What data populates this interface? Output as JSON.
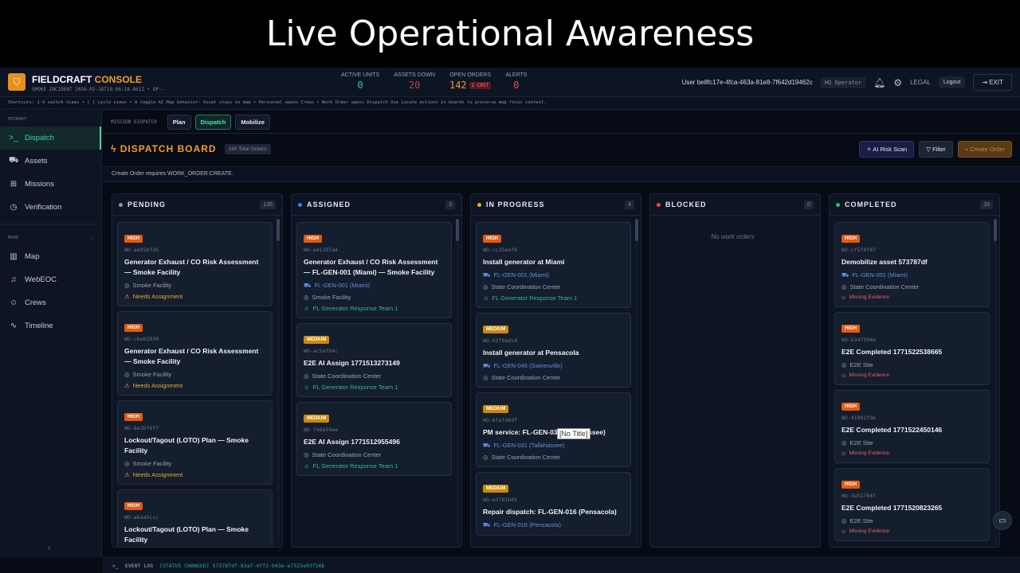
{
  "slide_title": "Live Operational Awareness",
  "header": {
    "brand_a": "FIELDCRAFT",
    "brand_b": "CONSOLE",
    "subtitle": "SMOKE INCIDENT 2026-02-16T19:06:18.861Z • OP--",
    "stats": [
      {
        "label": "ACTIVE UNITS",
        "value": "0",
        "color": "#2fc79a"
      },
      {
        "label": "ASSETS DOWN",
        "value": "20",
        "color": "#b8464c"
      },
      {
        "label": "OPEN ORDERS",
        "value": "142",
        "color": "#f1a02a",
        "badge": "1 CRIT"
      },
      {
        "label": "ALERTS",
        "value": "0",
        "color": "#e2555c"
      }
    ],
    "user": "User be8fc17e-4fca-463a-81e8-7f642d19462c",
    "role": "HQ Operator",
    "legal": "LEGAL",
    "logout": "Logout",
    "exit": "EXIT"
  },
  "shortcuts": "Shortcuts: 1-9 switch views • [ ] cycle views • A toggle AI    Map behavior: Asset stays on map • Personnel opens Crews • Work Order opens Dispatch    Use Locate actions in boards to preserve map focus context.",
  "sidebar": {
    "primary_label": "PRIMARY",
    "more_label": "MORE",
    "primary": [
      {
        "label": "Dispatch",
        "icon": "terminal-icon",
        "g": ">_",
        "active": true
      },
      {
        "label": "Assets",
        "icon": "truck-icon",
        "g": "⛟"
      },
      {
        "label": "Missions",
        "icon": "grid-icon",
        "g": "⊞"
      },
      {
        "label": "Verification",
        "icon": "check-circle-icon",
        "g": "◷"
      }
    ],
    "more": [
      {
        "label": "Map",
        "icon": "map-icon",
        "g": "▥"
      },
      {
        "label": "WebEOC",
        "icon": "bell-icon",
        "g": "♫"
      },
      {
        "label": "Crews",
        "icon": "users-icon",
        "g": "☺"
      },
      {
        "label": "Timeline",
        "icon": "activity-icon",
        "g": "∿"
      }
    ]
  },
  "mission": {
    "label": "MISSION DISPATCH",
    "tabs": [
      {
        "label": "Plan"
      },
      {
        "label": "Dispatch",
        "active": true
      },
      {
        "label": "Mobilize"
      }
    ]
  },
  "board": {
    "title": "DISPATCH BOARD",
    "total": "160 Total Orders",
    "ai": "AI Risk Scan",
    "filter": "Filter",
    "create": "+ Create Order",
    "note": "Create Order requires WORK_ORDER:CREATE.",
    "empty": "No work orders"
  },
  "columns": [
    {
      "name": "PENDING",
      "count": "135",
      "color": "#8a93a3",
      "cards": [
        {
          "p": "HIGH",
          "id": "WO-add5bf26",
          "title": "Generator Exhaust / CO Risk Assessment — Smoke Facility",
          "loc": "Smoke Facility",
          "flag": "Needs Assignment"
        },
        {
          "p": "HIGH",
          "id": "WO-cbeb2838",
          "title": "Generator Exhaust / CO Risk Assessment — Smoke Facility",
          "loc": "Smoke Facility",
          "flag": "Needs Assignment"
        },
        {
          "p": "HIGH",
          "id": "WO-8e2bf4ff",
          "title": "Lockout/Tagout (LOTO) Plan — Smoke Facility",
          "loc": "Smoke Facility",
          "flag": "Needs Assignment"
        },
        {
          "p": "HIGH",
          "id": "WO-a6aa5ccc",
          "title": "Lockout/Tagout (LOTO) Plan — Smoke Facility"
        }
      ]
    },
    {
      "name": "ASSIGNED",
      "count": "3",
      "color": "#3b82f6",
      "cards": [
        {
          "p": "HIGH",
          "id": "WO-e41387a4",
          "title": "Generator Exhaust / CO Risk Assessment — FL-GEN-001 (Miami) — Smoke Facility",
          "asset": "FL-GEN-001 (Miami)",
          "loc": "Smoke Facility",
          "team": "FL Generator Response Team 1"
        },
        {
          "p": "MEDIUM",
          "id": "WO-ac5afb4c",
          "title": "E2E AI Assign 1771513273149",
          "loc": "State Coordination Center",
          "team": "FL Generator Response Team 1"
        },
        {
          "p": "MEDIUM",
          "id": "WO-f46e59ee",
          "title": "E2E AI Assign 1771512955496",
          "loc": "State Coordination Center",
          "team": "FL Generator Response Team 1"
        }
      ]
    },
    {
      "name": "IN PROGRESS",
      "count": "4",
      "color": "#eab308",
      "cards": [
        {
          "p": "HIGH",
          "id": "WO-cc25eaf6",
          "title": "Install generator at Miami",
          "asset": "FL-GEN-001 (Miami)",
          "loc": "State Coordination Center",
          "team": "FL Generator Response Team 1"
        },
        {
          "p": "MEDIUM",
          "id": "WO-63f9adcd",
          "title": "Install generator at Pensacola",
          "asset": "FL-GEN-046 (Gainesville)",
          "loc": "State Coordination Center"
        },
        {
          "p": "MEDIUM",
          "id": "WO-8fefd8df",
          "title": "PM service: FL-GEN-031 (Tallahassee)",
          "asset": "FL-GEN-031 (Tallahassee)",
          "loc": "State Coordination Center"
        },
        {
          "p": "MEDIUM",
          "id": "WO-e3781b01",
          "title": "Repair dispatch: FL-GEN-016 (Pensacola)",
          "asset": "FL-GEN-016 (Pensacola)"
        }
      ]
    },
    {
      "name": "BLOCKED",
      "count": "0",
      "color": "#ef4444",
      "cards": []
    },
    {
      "name": "COMPLETED",
      "count": "18",
      "color": "#22c55e",
      "cards": [
        {
          "p": "HIGH",
          "id": "WO-cf5f8f87",
          "title": "Demobilize asset 573787df",
          "asset": "FL-GEN-001 (Miami)",
          "loc": "State Coordination Center",
          "miss": "Missing Evidence"
        },
        {
          "p": "HIGH",
          "id": "WO-b347594e",
          "title": "E2E Completed 1771522538665",
          "loc": "E2E Site",
          "miss": "Missing Evidence"
        },
        {
          "p": "HIGH",
          "id": "WO-41892f9e",
          "title": "E2E Completed 1771522450146",
          "loc": "E2E Site",
          "miss": "Missing Evidence"
        },
        {
          "p": "HIGH",
          "id": "WO-3a51704f",
          "title": "E2E Completed 1771520823265",
          "loc": "E2E Site",
          "miss": "Missing Evidence"
        }
      ]
    }
  ],
  "tooltip": "[No Title]",
  "event_log": {
    "label": "EVENT LOG",
    "message": "[STATUS CHANGED] 573787df-83a7-4ff2-b43e-e7525e93f56b"
  }
}
